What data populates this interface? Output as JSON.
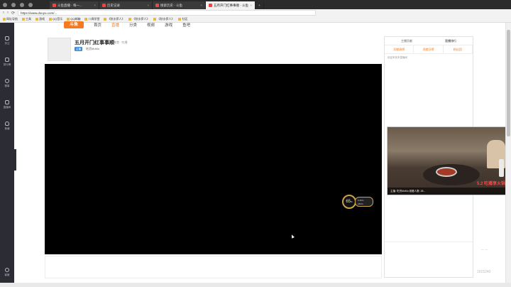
{
  "browser": {
    "tabs": [
      {
        "title": "斗鱼直播 - 每一...",
        "active": false
      },
      {
        "title": "历史记录",
        "active": false
      },
      {
        "title": "搜索历史 - 斗鱼",
        "active": false
      },
      {
        "title": "五月开门红事事顺 - 斗鱼",
        "active": true
      }
    ],
    "new_tab": "+",
    "url": "https://www.douyu.com/...",
    "bookmarks": [
      "网址导航",
      "工具",
      "游戏",
      "QQ音乐",
      "QQ邮箱",
      "八闽学堂",
      "《秋水伊人》",
      "《秋水伊人》",
      "《秋水伊人》",
      "社区"
    ]
  },
  "site": {
    "logo": "斗鱼",
    "nav": [
      "首页",
      "直播",
      "分类",
      "视频",
      "游戏",
      "鱼吧"
    ],
    "nav_active_index": 1
  },
  "sidebar": {
    "items": [
      "关注",
      "排行榜",
      "赛事",
      "直播间",
      "鱼塘"
    ],
    "bottom": "客服"
  },
  "room": {
    "title": "五月开门红事事顺",
    "category": "美食 · 吃播",
    "badge": "主播",
    "anchor": "吃货MoMo"
  },
  "player": {
    "gauge_value": "65",
    "gauge_unit": "%",
    "gauge_panel_line1": "0.4K/s",
    "gauge_panel_line2": "24K/s"
  },
  "chat": {
    "tabs": [
      "主播贡献",
      "直播排行"
    ],
    "subtabs": [
      "贡献周榜",
      "贡献日榜",
      "粉丝团"
    ],
    "empty_text": "欢迎来到本直播间"
  },
  "miniplayer": {
    "caption": "主播: 吃货MoMo  观看人数: 28...",
    "overlay": "5.2 吃播享火锅"
  },
  "watermark": "1615240",
  "tools_label": "— —"
}
